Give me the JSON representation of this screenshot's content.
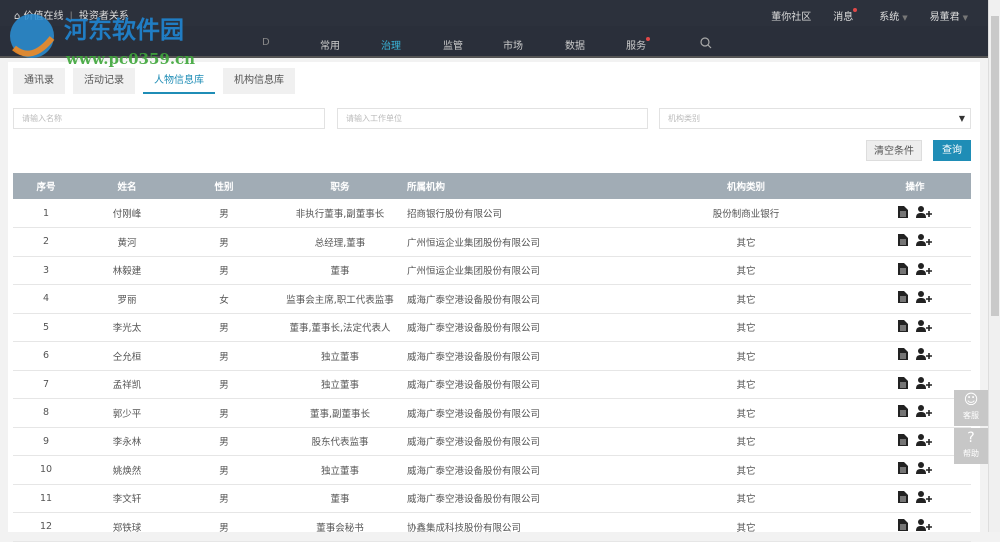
{
  "header": {
    "brand": "价值在线",
    "subtitle": "投资者关系",
    "links": [
      {
        "label": "董你社区"
      },
      {
        "label": "消息",
        "dot": true
      },
      {
        "label": "系统",
        "caret": true
      },
      {
        "label": "易董君",
        "caret": true
      }
    ]
  },
  "nav": {
    "items": [
      {
        "label": "常用"
      },
      {
        "label": "治理",
        "active": true
      },
      {
        "label": "监管"
      },
      {
        "label": "市场"
      },
      {
        "label": "数据"
      },
      {
        "label": "服务",
        "dot": true
      }
    ]
  },
  "tabs": [
    {
      "label": "通讯录"
    },
    {
      "label": "活动记录"
    },
    {
      "label": "人物信息库",
      "active": true
    },
    {
      "label": "机构信息库"
    }
  ],
  "filters": {
    "name_placeholder": "请输入名称",
    "unit_placeholder": "请输入工作单位",
    "category_placeholder": "机构类别",
    "clear_label": "清空条件",
    "search_label": "查询"
  },
  "table": {
    "headers": [
      "序号",
      "姓名",
      "性别",
      "职务",
      "所属机构",
      "机构类别",
      "操作"
    ],
    "rows": [
      [
        "1",
        "付刚峰",
        "男",
        "非执行董事,副董事长",
        "招商银行股份有限公司",
        "股份制商业银行"
      ],
      [
        "2",
        "黄河",
        "男",
        "总经理,董事",
        "广州恒运企业集团股份有限公司",
        "其它"
      ],
      [
        "3",
        "林毅建",
        "男",
        "董事",
        "广州恒运企业集团股份有限公司",
        "其它"
      ],
      [
        "4",
        "罗丽",
        "女",
        "监事会主席,职工代表监事",
        "威海广泰空港设备股份有限公司",
        "其它"
      ],
      [
        "5",
        "李光太",
        "男",
        "董事,董事长,法定代表人",
        "威海广泰空港设备股份有限公司",
        "其它"
      ],
      [
        "6",
        "仝允桓",
        "男",
        "独立董事",
        "威海广泰空港设备股份有限公司",
        "其它"
      ],
      [
        "7",
        "孟祥凯",
        "男",
        "独立董事",
        "威海广泰空港设备股份有限公司",
        "其它"
      ],
      [
        "8",
        "郭少平",
        "男",
        "董事,副董事长",
        "威海广泰空港设备股份有限公司",
        "其它"
      ],
      [
        "9",
        "李永林",
        "男",
        "股东代表监事",
        "威海广泰空港设备股份有限公司",
        "其它"
      ],
      [
        "10",
        "姚焕然",
        "男",
        "独立董事",
        "威海广泰空港设备股份有限公司",
        "其它"
      ],
      [
        "11",
        "李文轩",
        "男",
        "董事",
        "威海广泰空港设备股份有限公司",
        "其它"
      ],
      [
        "12",
        "郑铁球",
        "男",
        "董事会秘书",
        "协鑫集成科技股份有限公司",
        "其它"
      ]
    ]
  },
  "side": {
    "service": "客服",
    "help": "帮助"
  },
  "watermark": {
    "title": "河东软件园",
    "url": "www.pc0359.cn"
  },
  "colors": {
    "accent": "#1f8db6",
    "header": "#2c313c",
    "table_header": "#a1acb5"
  }
}
